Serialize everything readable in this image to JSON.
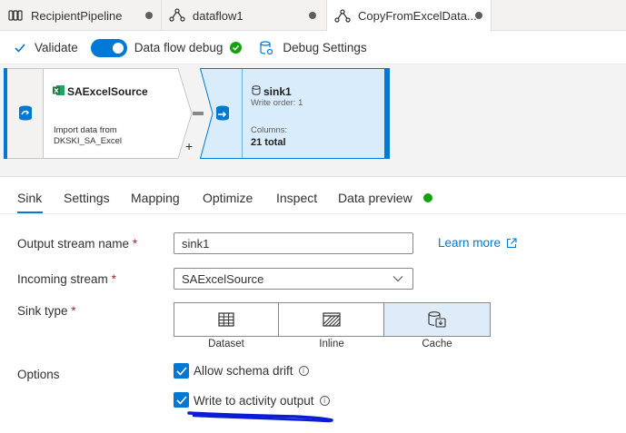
{
  "tabs": [
    {
      "label": "RecipientPipeline",
      "icon": "pipeline-icon",
      "active": false
    },
    {
      "label": "dataflow1",
      "icon": "dataflow-icon",
      "active": false
    },
    {
      "label": "CopyFromExcelData...",
      "icon": "dataflow-icon",
      "active": true
    }
  ],
  "toolbar": {
    "validate_label": "Validate",
    "debug_label": "Data flow debug",
    "debug_settings_label": "Debug Settings"
  },
  "canvas": {
    "source": {
      "title": "SAExcelSource",
      "description": "Import data from DKSKI_SA_Excel"
    },
    "add_symbol": "+",
    "sink": {
      "title": "sink1",
      "write_order": "Write order: 1",
      "columns_label": "Columns:",
      "columns_value": "21 total"
    }
  },
  "property_tabs": [
    "Sink",
    "Settings",
    "Mapping",
    "Optimize",
    "Inspect",
    "Data preview"
  ],
  "form": {
    "output_stream_label": "Output stream name",
    "output_stream_value": "sink1",
    "learn_more": "Learn more",
    "incoming_stream_label": "Incoming stream",
    "incoming_stream_value": "SAExcelSource",
    "sink_type_label": "Sink type",
    "sink_type_options": [
      "Dataset",
      "Inline",
      "Cache"
    ],
    "sink_type_selected": "Cache",
    "options_label": "Options",
    "required_mark": "*",
    "allow_schema_drift": "Allow schema drift",
    "write_to_activity_output": "Write to activity output"
  },
  "colors": {
    "accent": "#0078d4",
    "success": "#13a10e",
    "excel": "#217346",
    "annotation": "#0a1cd6"
  }
}
